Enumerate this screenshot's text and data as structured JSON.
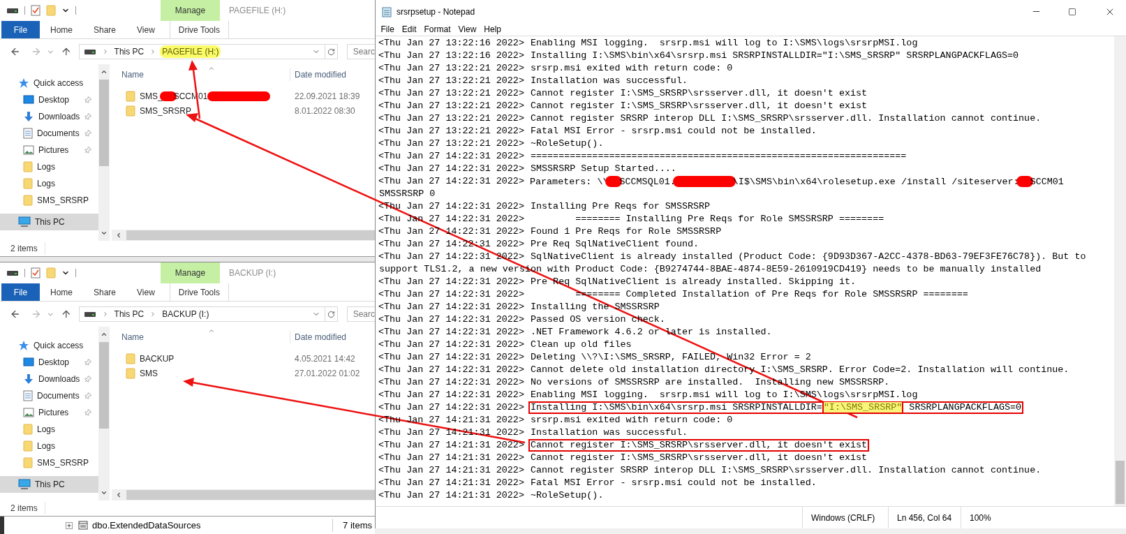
{
  "explorers": [
    {
      "title": "PAGEFILE (H:)",
      "context_header": "Manage",
      "ribbon_tabs": [
        {
          "label": "File",
          "kind": "file"
        },
        {
          "label": "Home",
          "kind": "plain"
        },
        {
          "label": "Share",
          "kind": "plain"
        },
        {
          "label": "View",
          "kind": "plain"
        },
        {
          "label": "Drive Tools",
          "kind": "context"
        }
      ],
      "path": [
        {
          "label": "This PC",
          "highlighted": false
        },
        {
          "label": "PAGEFILE (H:)",
          "highlighted": true
        }
      ],
      "search": "Searc",
      "nav": [
        {
          "label": "Quick access",
          "kind": "quick-access",
          "pinned": false,
          "selected": false
        },
        {
          "label": "Desktop",
          "kind": "desktop",
          "pinned": true,
          "selected": false
        },
        {
          "label": "Downloads",
          "kind": "downloads",
          "pinned": true,
          "selected": false
        },
        {
          "label": "Documents",
          "kind": "documents",
          "pinned": true,
          "selected": false
        },
        {
          "label": "Pictures",
          "kind": "pictures",
          "pinned": true,
          "selected": false
        },
        {
          "label": "Logs",
          "kind": "folder",
          "pinned": false,
          "selected": false
        },
        {
          "label": "Logs",
          "kind": "folder",
          "pinned": false,
          "selected": false
        },
        {
          "label": "SMS_SRSRP",
          "kind": "folder",
          "pinned": false,
          "selected": false
        },
        {
          "label": "This PC",
          "kind": "pc",
          "pinned": false,
          "selected": true
        }
      ],
      "columns": [
        "Name",
        "Date modified"
      ],
      "items": [
        {
          "name": [
            {
              "kind": "text",
              "text": "SMS_"
            },
            {
              "kind": "redacted-short"
            },
            {
              "kind": "text",
              "text": "SCCM01."
            },
            {
              "kind": "redacted-long"
            }
          ],
          "date": "22.09.2021 18:39"
        },
        {
          "name": [
            {
              "kind": "text",
              "text": "SMS_SRSRP"
            }
          ],
          "date": "8.01.2022 08:30"
        }
      ],
      "status": "2 items"
    },
    {
      "title": "BACKUP (I:)",
      "context_header": "Manage",
      "ribbon_tabs": [
        {
          "label": "File",
          "kind": "file"
        },
        {
          "label": "Home",
          "kind": "plain"
        },
        {
          "label": "Share",
          "kind": "plain"
        },
        {
          "label": "View",
          "kind": "plain"
        },
        {
          "label": "Drive Tools",
          "kind": "context"
        }
      ],
      "path": [
        {
          "label": "This PC",
          "highlighted": false
        },
        {
          "label": "BACKUP (I:)",
          "highlighted": false
        }
      ],
      "search": "Searc",
      "nav": [
        {
          "label": "Quick access",
          "kind": "quick-access",
          "pinned": false,
          "selected": false
        },
        {
          "label": "Desktop",
          "kind": "desktop",
          "pinned": true,
          "selected": false
        },
        {
          "label": "Downloads",
          "kind": "downloads",
          "pinned": true,
          "selected": false
        },
        {
          "label": "Documents",
          "kind": "documents",
          "pinned": true,
          "selected": false
        },
        {
          "label": "Pictures",
          "kind": "pictures",
          "pinned": true,
          "selected": false
        },
        {
          "label": "Logs",
          "kind": "folder",
          "pinned": false,
          "selected": false
        },
        {
          "label": "Logs",
          "kind": "folder",
          "pinned": false,
          "selected": false
        },
        {
          "label": "SMS_SRSRP",
          "kind": "folder",
          "pinned": false,
          "selected": false
        },
        {
          "label": "This PC",
          "kind": "pc",
          "pinned": false,
          "selected": true
        }
      ],
      "columns": [
        "Name",
        "Date modified"
      ],
      "items": [
        {
          "name": [
            {
              "kind": "text",
              "text": "BACKUP"
            }
          ],
          "date": "4.05.2021 14:42"
        },
        {
          "name": [
            {
              "kind": "text",
              "text": "SMS"
            }
          ],
          "date": "27.01.2022 01:02"
        }
      ],
      "status": "2 items"
    }
  ],
  "background_window": {
    "tree_item": "dbo.ExtendedDataSources",
    "status": "7 items"
  },
  "notepad": {
    "title": "srsrpsetup - Notepad",
    "menu": [
      "File",
      "Edit",
      "Format",
      "View",
      "Help"
    ],
    "lines": [
      {
        "time": "<Thu Jan 27 13:22:16 2022>",
        "message": "Enabling MSI logging.  srsrp.msi will log to I:\\SMS\\logs\\srsrpMSI.log",
        "boxed": false
      },
      {
        "time": "<Thu Jan 27 13:22:16 2022>",
        "message": "Installing I:\\SMS\\bin\\x64\\srsrp.msi SRSRPINSTALLDIR=\"I:\\SMS_SRSRP\" SRSRPLANGPACKFLAGS=0",
        "boxed": false
      },
      {
        "time": "<Thu Jan 27 13:22:21 2022>",
        "message": "srsrp.msi exited with return code: 0",
        "boxed": false
      },
      {
        "time": "<Thu Jan 27 13:22:21 2022>",
        "message": "Installation was successful.",
        "boxed": false
      },
      {
        "time": "<Thu Jan 27 13:22:21 2022>",
        "message": "Cannot register I:\\SMS_SRSRP\\srsserver.dll, it doesn't exist",
        "boxed": false
      },
      {
        "time": "<Thu Jan 27 13:22:21 2022>",
        "message": "Cannot register I:\\SMS_SRSRP\\srsserver.dll, it doesn't exist",
        "boxed": false
      },
      {
        "time": "<Thu Jan 27 13:22:21 2022>",
        "message": "Cannot register SRSRP interop DLL I:\\SMS_SRSRP\\srsserver.dll. Installation cannot continue.",
        "boxed": false
      },
      {
        "time": "<Thu Jan 27 13:22:21 2022>",
        "message": "Fatal MSI Error - srsrp.msi could not be installed.",
        "boxed": false
      },
      {
        "time": "<Thu Jan 27 13:22:21 2022>",
        "message": "~RoleSetup().",
        "boxed": false
      },
      {
        "time": "<Thu Jan 27 14:22:31 2022>",
        "message": "===================================================================",
        "boxed": false
      },
      {
        "time": "<Thu Jan 27 14:22:31 2022>",
        "message": "SMSSRSRP Setup Started....",
        "boxed": false
      },
      {
        "time": "<Thu Jan 27 14:22:31 2022>",
        "segments": [
          {
            "kind": "text",
            "text": "Parameters: \\\\"
          },
          {
            "kind": "redacted-short"
          },
          {
            "kind": "text",
            "text": "SCCMSQL01."
          },
          {
            "kind": "redacted-long"
          },
          {
            "kind": "text",
            "text": "\\I$\\SMS\\bin\\x64\\rolesetup.exe /install /siteserver:"
          },
          {
            "kind": "redacted-short"
          },
          {
            "kind": "text",
            "text": "SCCM01"
          }
        ],
        "boxed": false
      },
      {
        "message": "SMSSRSRP 0",
        "boxed": false
      },
      {
        "time": "<Thu Jan 27 14:22:31 2022>",
        "message": "Installing Pre Reqs for SMSSRSRP",
        "boxed": false
      },
      {
        "time": "<Thu Jan 27 14:22:31 2022>",
        "message": "        ======== Installing Pre Reqs for Role SMSSRSRP ========",
        "boxed": false
      },
      {
        "time": "<Thu Jan 27 14:22:31 2022>",
        "message": "Found 1 Pre Reqs for Role SMSSRSRP",
        "boxed": false
      },
      {
        "time": "<Thu Jan 27 14:22:31 2022>",
        "message": "Pre Req SqlNativeClient found.",
        "boxed": false
      },
      {
        "time": "<Thu Jan 27 14:22:31 2022>",
        "message": "SqlNativeClient is already installed (Product Code: {9D93D367-A2CC-4378-BD63-79EF3FE76C78}). But to",
        "boxed": false
      },
      {
        "message": "support TLS1.2, a new version with Product Code: {B9274744-8BAE-4874-8E59-2610919CD419} needs to be manually installed",
        "boxed": false
      },
      {
        "time": "<Thu Jan 27 14:22:31 2022>",
        "message": "Pre Req SqlNativeClient is already installed. Skipping it.",
        "boxed": false
      },
      {
        "time": "<Thu Jan 27 14:22:31 2022>",
        "message": "        ======== Completed Installation of Pre Reqs for Role SMSSRSRP ========",
        "boxed": false
      },
      {
        "time": "<Thu Jan 27 14:22:31 2022>",
        "message": "Installing the SMSSRSRP",
        "boxed": false
      },
      {
        "time": "<Thu Jan 27 14:22:31 2022>",
        "message": "Passed OS version check.",
        "boxed": false
      },
      {
        "time": "<Thu Jan 27 14:22:31 2022>",
        "message": ".NET Framework 4.6.2 or later is installed.",
        "boxed": false
      },
      {
        "time": "<Thu Jan 27 14:22:31 2022>",
        "message": "Clean up old files",
        "boxed": false
      },
      {
        "time": "<Thu Jan 27 14:22:31 2022>",
        "message": "Deleting \\\\?\\I:\\SMS_SRSRP, FAILED, Win32 Error = 2",
        "boxed": false
      },
      {
        "time": "<Thu Jan 27 14:22:31 2022>",
        "message": "Cannot delete old installation directory I:\\SMS_SRSRP. Error Code=2. Installation will continue.",
        "boxed": false
      },
      {
        "time": "<Thu Jan 27 14:22:31 2022>",
        "message": "No versions of SMSSRSRP are installed.  Installing new SMSSRSRP.",
        "boxed": false
      },
      {
        "time": "<Thu Jan 27 14:22:31 2022>",
        "message": "Enabling MSI logging.  srsrp.msi will log to I:\\SMS\\logs\\srsrpMSI.log",
        "boxed": false
      },
      {
        "time": "<Thu Jan 27 14:22:31 2022>",
        "segments": [
          {
            "kind": "text",
            "text": "Installing I:\\SMS\\bin\\x64\\srsrp.msi SRSRPINSTALLDIR="
          },
          {
            "kind": "highlight",
            "text": "\"I:\\SMS_SRSRP\""
          },
          {
            "kind": "text",
            "text": " SRSRPLANGPACKFLAGS=0"
          }
        ],
        "boxed": true
      },
      {
        "time": "<Thu Jan 27 14:21:31 2022>",
        "message": "srsrp.msi exited with return code: 0",
        "boxed": false
      },
      {
        "time": "<Thu Jan 27 14:21:31 2022>",
        "message": "Installation was successful.",
        "boxed": false
      },
      {
        "time": "<Thu Jan 27 14:21:31 2022>",
        "message": "Cannot register I:\\SMS_SRSRP\\srsserver.dll, it doesn't exist",
        "boxed": true
      },
      {
        "time": "<Thu Jan 27 14:21:31 2022>",
        "message": "Cannot register I:\\SMS_SRSRP\\srsserver.dll, it doesn't exist",
        "boxed": false
      },
      {
        "time": "<Thu Jan 27 14:21:31 2022>",
        "message": "Cannot register SRSRP interop DLL I:\\SMS_SRSRP\\srsserver.dll. Installation cannot continue.",
        "boxed": false
      },
      {
        "time": "<Thu Jan 27 14:21:31 2022>",
        "message": "Fatal MSI Error - srsrp.msi could not be installed.",
        "boxed": false
      },
      {
        "time": "<Thu Jan 27 14:21:31 2022>",
        "message": "~RoleSetup().",
        "boxed": false
      }
    ],
    "status": {
      "line_ending": "Windows (CRLF)",
      "position": "Ln 456, Col 64",
      "zoom": "100%"
    }
  }
}
